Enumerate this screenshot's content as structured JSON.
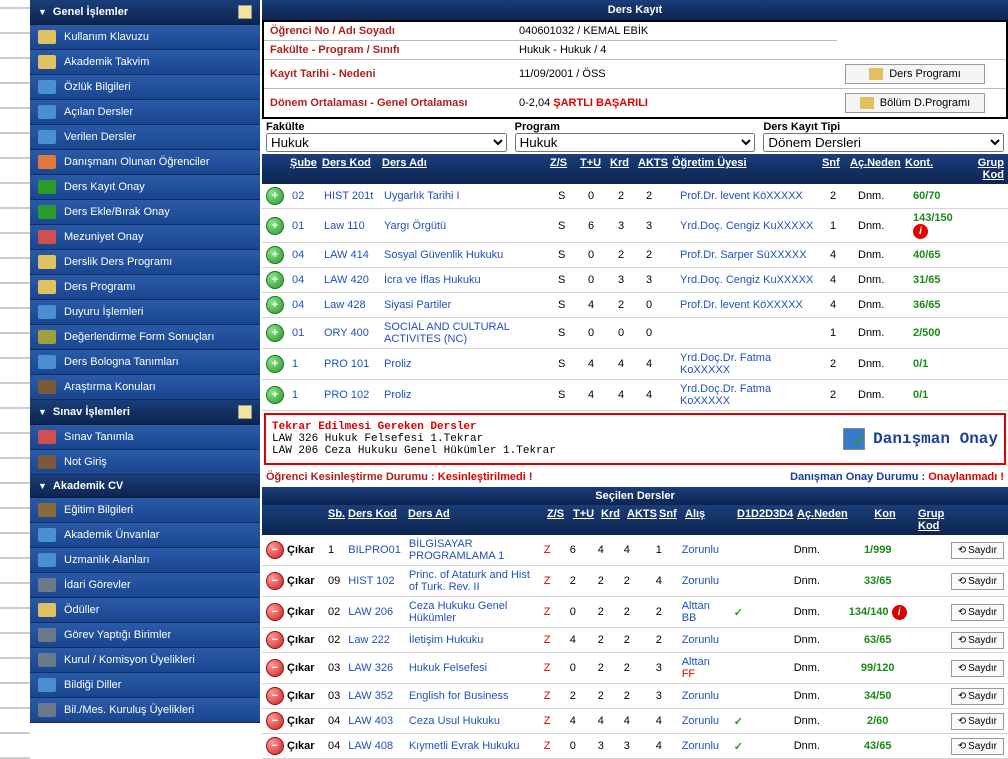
{
  "sidebar": {
    "s1": {
      "title": "Genel İşlemler",
      "items": [
        "Kullanım Klavuzu",
        "Akademik Takvim",
        "Özlük Bilgileri",
        "Açılan Dersler",
        "Verilen Dersler",
        "Danışmanı Olunan Öğrenciler",
        "Ders Kayıt Onay",
        "Ders Ekle/Bırak Onay",
        "Mezuniyet Onay",
        "Derslik Ders Programı",
        "Ders Programı",
        "Duyuru İşlemleri",
        "Değerlendirme Form Sonuçları",
        "Ders Bologna Tanımları",
        "Araştırma Konuları"
      ]
    },
    "s2": {
      "title": "Sınav İşlemleri",
      "items": [
        "Sınav Tanımla",
        "Not Giriş"
      ]
    },
    "s3": {
      "title": "Akademik CV",
      "items": [
        "Eğitim Bilgileri",
        "Akademik Ünvanlar",
        "Uzmanlık Alanları",
        "İdari Görevler",
        "Ödüller",
        "Görev Yaptığı Birimler",
        "Kurul / Komisyon Üyelikleri",
        "Bildiği Diller",
        "Bil./Mes. Kuruluş Üyelikleri"
      ]
    }
  },
  "page_title": "Ders Kayıt",
  "info": {
    "r1_label": "Öğrenci No / Adı Soyadı",
    "r1_val": "040601032 / KEMAL EBİK",
    "r2_label": "Fakülte - Program / Sınıfı",
    "r2_val": "Hukuk - Hukuk / 4",
    "r3_label": "Kayıt Tarihi - Nedeni",
    "r3_val": "11/09/2001 / ÖSS",
    "r4_label": "Dönem Ortalaması - Genel Ortalaması",
    "r4_val": "0-2,04 ",
    "r4_red": "ŞARTLI BAŞARILI",
    "btn1": "Ders Programı",
    "btn2": "Bölüm D.Programı"
  },
  "filters": {
    "f1_label": "Fakülte",
    "f1_val": "Hukuk",
    "f2_label": "Program",
    "f2_val": "Hukuk",
    "f3_label": "Ders Kayıt Tipi",
    "f3_val": "Dönem Dersleri"
  },
  "avail_headers": {
    "sube": "Şube",
    "kod": "Ders Kod",
    "ad": "Ders Adı",
    "zs": "Z/S",
    "tu": "T+U",
    "krd": "Krd",
    "akts": "AKTS",
    "ouyesi": "Öğretim Üyesi",
    "snf": "Snf",
    "neden": "Aç.Neden",
    "kont": "Kont.",
    "grup": "Grup Kod"
  },
  "avail": [
    {
      "sb": "02",
      "kod": "HIST 201t",
      "ad": "Uygarlık Tarihi I",
      "zs": "S",
      "tu": "0",
      "krd": "2",
      "akts": "2",
      "ogr": "Prof.Dr. levent KöXXXXX",
      "snf": "2",
      "ned": "Dnm.",
      "kont": "60/70",
      "warn": false
    },
    {
      "sb": "01",
      "kod": "Law 110",
      "ad": "Yargı Örgütü",
      "zs": "S",
      "tu": "6",
      "krd": "3",
      "akts": "3",
      "ogr": "Yrd.Doç. Cengiz KuXXXXX",
      "snf": "1",
      "ned": "Dnm.",
      "kont": "143/150",
      "warn": true
    },
    {
      "sb": "04",
      "kod": "LAW 414",
      "ad": "Sosyal Güvenlik Hukuku",
      "zs": "S",
      "tu": "0",
      "krd": "2",
      "akts": "2",
      "ogr": "Prof.Dr. Sarper SüXXXXX",
      "snf": "4",
      "ned": "Dnm.",
      "kont": "40/65",
      "warn": false
    },
    {
      "sb": "04",
      "kod": "LAW 420",
      "ad": "İcra ve İflas Hukuku",
      "zs": "S",
      "tu": "0",
      "krd": "3",
      "akts": "3",
      "ogr": "Yrd.Doç. Cengiz KuXXXXX",
      "snf": "4",
      "ned": "Dnm.",
      "kont": "31/65",
      "warn": false
    },
    {
      "sb": "04",
      "kod": "Law 428",
      "ad": "Siyasi Partiler",
      "zs": "S",
      "tu": "4",
      "krd": "2",
      "akts": "0",
      "ogr": "Prof.Dr. levent KöXXXXX",
      "snf": "4",
      "ned": "Dnm.",
      "kont": "36/65",
      "warn": false
    },
    {
      "sb": "01",
      "kod": "ORY 400",
      "ad": "SOCIAL AND CULTURAL ACTIVITES (NC)",
      "zs": "S",
      "tu": "0",
      "krd": "0",
      "akts": "0",
      "ogr": "",
      "snf": "1",
      "ned": "Dnm.",
      "kont": "2/500",
      "warn": false
    },
    {
      "sb": "1",
      "kod": "PRO 101",
      "ad": "Proliz",
      "zs": "S",
      "tu": "4",
      "krd": "4",
      "akts": "4",
      "ogr": "Yrd.Doç.Dr. Fatma KoXXXXX",
      "snf": "2",
      "ned": "Dnm.",
      "kont": "0/1",
      "warn": false
    },
    {
      "sb": "1",
      "kod": "PRO 102",
      "ad": "Proliz",
      "zs": "S",
      "tu": "4",
      "krd": "4",
      "akts": "4",
      "ogr": "Yrd.Doç.Dr. Fatma KoXXXXX",
      "snf": "2",
      "ned": "Dnm.",
      "kont": "0/1",
      "warn": false
    }
  ],
  "repeat": {
    "title": "Tekrar Edilmesi Gereken Dersler",
    "l1": "LAW 326 Hukuk Felsefesi 1.Tekrar",
    "l2": "LAW 206 Ceza Hukuku Genel Hükümler 1.Tekrar",
    "approve": "Danışman Onay"
  },
  "status": {
    "l1": "Öğrenci Kesinleştirme Durumu : ",
    "v1": "Kesinleştirilmedi !",
    "l2": "Danışman Onay Durumu : ",
    "v2": "Onaylanmadı !"
  },
  "sel_title": "Seçilen Dersler",
  "sel_headers": {
    "sb": "Sb.",
    "kod": "Ders Kod",
    "ad": "Ders Ad",
    "zs": "Z/S",
    "tu": "T+U",
    "krd": "Krd",
    "akts": "AKTS",
    "snf": "Snf",
    "alis": "Alış",
    "d": "D1D2D3D4",
    "neden": "Aç.Neden",
    "kon": "Kon",
    "grup": "Grup Kod"
  },
  "cikar": "Çıkar",
  "saydir": "Saydır",
  "sel": [
    {
      "sb": "1",
      "kod": "BILPRO01",
      "ad": "BİLGİSAYAR PROGRAMLAMA 1",
      "zs": "Z",
      "tu": "6",
      "krd": "4",
      "akts": "4",
      "snf": "1",
      "alis": "Zorunlu",
      "d": "",
      "dred": "",
      "chk": false,
      "ned": "Dnm.",
      "kon": "1/999",
      "warn": false
    },
    {
      "sb": "09",
      "kod": "HIST 102",
      "ad": "Princ. of Ataturk and Hist of Turk. Rev. II",
      "zs": "Z",
      "tu": "2",
      "krd": "2",
      "akts": "2",
      "snf": "4",
      "alis": "Zorunlu",
      "d": "",
      "dred": "",
      "chk": false,
      "ned": "Dnm.",
      "kon": "33/65",
      "warn": false
    },
    {
      "sb": "02",
      "kod": "LAW 206",
      "ad": "Ceza Hukuku Genel Hükümler",
      "zs": "Z",
      "tu": "0",
      "krd": "2",
      "akts": "2",
      "snf": "2",
      "alis": "Alttan",
      "d": "BB",
      "dred": "",
      "chk": true,
      "ned": "Dnm.",
      "kon": "134/140",
      "warn": true
    },
    {
      "sb": "02",
      "kod": "Law 222",
      "ad": "İletişim Hukuku",
      "zs": "Z",
      "tu": "4",
      "krd": "2",
      "akts": "2",
      "snf": "2",
      "alis": "Zorunlu",
      "d": "",
      "dred": "",
      "chk": false,
      "ned": "Dnm.",
      "kon": "63/65",
      "warn": false
    },
    {
      "sb": "03",
      "kod": "LAW 326",
      "ad": "Hukuk Felsefesi",
      "zs": "Z",
      "tu": "0",
      "krd": "2",
      "akts": "2",
      "snf": "3",
      "alis": "Alttan",
      "d": "",
      "dred": "FF",
      "chk": false,
      "ned": "Dnm.",
      "kon": "99/120",
      "warn": false
    },
    {
      "sb": "03",
      "kod": "LAW 352",
      "ad": "English for Business",
      "zs": "Z",
      "tu": "2",
      "krd": "2",
      "akts": "2",
      "snf": "3",
      "alis": "Zorunlu",
      "d": "",
      "dred": "",
      "chk": false,
      "ned": "Dnm.",
      "kon": "34/50",
      "warn": false
    },
    {
      "sb": "04",
      "kod": "LAW 403",
      "ad": "Ceza Usul Hukuku",
      "zs": "Z",
      "tu": "4",
      "krd": "4",
      "akts": "4",
      "snf": "4",
      "alis": "Zorunlu",
      "d": "",
      "dred": "",
      "chk": true,
      "ned": "Dnm.",
      "kon": "2/60",
      "warn": false
    },
    {
      "sb": "04",
      "kod": "LAW 408",
      "ad": "Kıymetli Evrak Hukuku",
      "zs": "Z",
      "tu": "0",
      "krd": "3",
      "akts": "3",
      "snf": "4",
      "alis": "Zorunlu",
      "d": "",
      "dred": "",
      "chk": true,
      "ned": "Dnm.",
      "kon": "43/65",
      "warn": false
    }
  ]
}
